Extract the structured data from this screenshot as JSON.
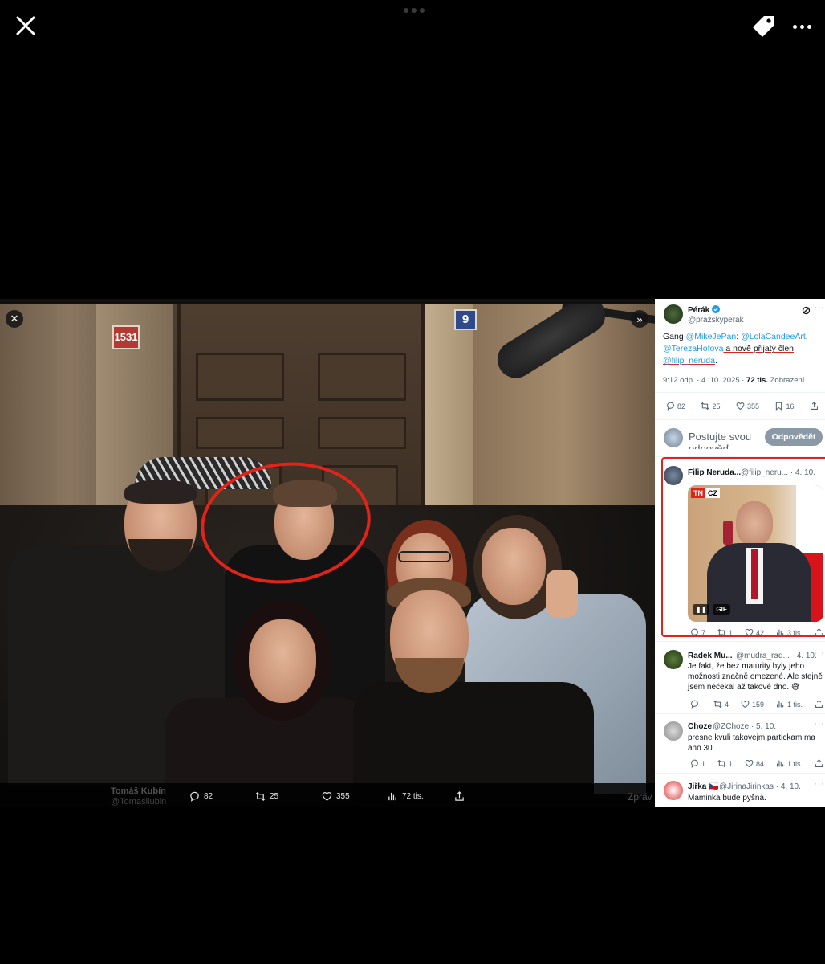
{
  "viewer": {
    "close_icon": "close-icon",
    "tag_icon": "tag-icon",
    "more_icon": "more-horizontal-icon"
  },
  "photo_signs": {
    "building_number": "1531",
    "house_number": "9"
  },
  "photo_bar": {
    "author_ghost": "Tomáš Kubín",
    "handle_ghost": "@Tomasilubin",
    "reply_count": "82",
    "retweet_count": "25",
    "like_count": "355",
    "view_count": "72 tis.",
    "next_label": "Zpráv"
  },
  "tweet": {
    "author": "Pérák",
    "handle": "@prazskyperak",
    "text_parts": {
      "p1": "Gang ",
      "m1": "@MikeJePan",
      "p2": ": ",
      "m2": "@LolaCandeeArt",
      "p3": ",",
      "m3": "@TerezaHofova",
      "p4": " a nově přijatý člen",
      "m4": "@filip_neruda",
      "p5": "."
    },
    "time": "9:12 odp. · 4. 10. 2025 · ",
    "views": "72 tis.",
    "views_label": " Zobrazení",
    "stats": {
      "replies": "82",
      "retweets": "25",
      "likes": "355",
      "bookmarks": "16"
    }
  },
  "reply_box": {
    "placeholder_line1": "Postujte svou",
    "placeholder_line2": "odpověď",
    "button": "Odpovědět"
  },
  "replies": [
    {
      "name": "Filip Neruda...",
      "handle": "@filip_neru... · 4. 10.",
      "gif_badge": "GIF",
      "tn_badge": "TN",
      "cz_badge": "CZ",
      "stats": {
        "replies": "7",
        "retweets": "1",
        "likes": "42",
        "views": "3 tis."
      }
    },
    {
      "name": "Radek Mu...",
      "handle": "@mudra_rad... · 4. 10.",
      "text": "Je fakt, že bez maturity byly jeho možnosti značně omezené. Ale stejně jsem nečekal až takové dno. 😅",
      "stats": {
        "replies": "",
        "retweets": "4",
        "likes": "159",
        "views": "1 tis."
      }
    },
    {
      "name": "Choze",
      "handle": "@ZChoze · 5. 10.",
      "text": "presne kvuli takovejm partickam ma ano 30",
      "stats": {
        "replies": "1",
        "retweets": "1",
        "likes": "84",
        "views": "1 tis."
      }
    },
    {
      "name": "Jiřka 🇨🇿",
      "handle": "@JirinaJirinkas · 4. 10.",
      "text": "Maminka bude pyšná."
    }
  ],
  "colors": {
    "annotation_red": "#e2231a",
    "link_blue": "#1d9bf0",
    "verified_blue": "#1d9bf0"
  }
}
